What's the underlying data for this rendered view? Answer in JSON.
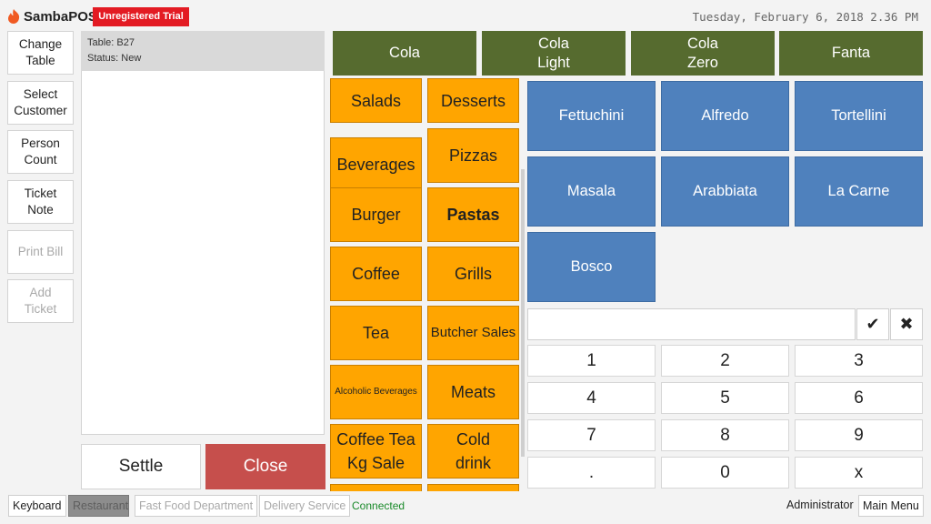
{
  "app": {
    "name": "SambaPOS",
    "trial_badge": "Unregistered Trial",
    "datetime": "Tuesday, February 6, 2018 2.36 PM",
    "logo_icon": "flame-icon",
    "brand_color": "#e31b23"
  },
  "commands": [
    {
      "label": "Change\nTable",
      "enabled": true
    },
    {
      "label": "Select\nCustomer",
      "enabled": true
    },
    {
      "label": "Person\nCount",
      "enabled": true
    },
    {
      "label": "Ticket\nNote",
      "enabled": true
    },
    {
      "label": "Print Bill",
      "enabled": false
    },
    {
      "label": "Add\nTicket",
      "enabled": false
    }
  ],
  "ticket": {
    "table": "Table: B27",
    "status": "Status: New",
    "settle_label": "Settle",
    "close_label": "Close",
    "close_color": "#c64f4c"
  },
  "favorites": [
    "Cola",
    "Cola\nLight",
    "Cola\nZero",
    "Fanta"
  ],
  "favorites_color": "#566b2f",
  "categories": [
    {
      "label": "Salads"
    },
    {
      "label": "Desserts"
    },
    {
      "label": "Beverages"
    },
    {
      "label": "Pizzas"
    },
    {
      "label": "Burger"
    },
    {
      "label": "Pastas",
      "selected": true
    },
    {
      "label": "Coffee"
    },
    {
      "label": "Grills"
    },
    {
      "label": "Tea"
    },
    {
      "label": "Butcher Sales"
    },
    {
      "label": "Alcoholic Beverages"
    },
    {
      "label": "Meats"
    },
    {
      "label": "Coffee Tea\nKg Sale"
    },
    {
      "label": "Cold\ndrink"
    }
  ],
  "categories_color": "#ffa500",
  "menu_items": [
    "Fettuchini",
    "Alfredo",
    "Tortellini",
    "Masala",
    "Arabbiata",
    "La Carne",
    "Bosco"
  ],
  "menu_items_color": "#4f81bd",
  "numpad": {
    "input_value": "",
    "ok_icon": "checkmark-icon",
    "clear_icon": "x-icon",
    "ok_glyph": "✔",
    "clear_glyph": "✖",
    "keys": [
      "1",
      "2",
      "3",
      "4",
      "5",
      "6",
      "7",
      "8",
      "9",
      ".",
      "0",
      "x"
    ]
  },
  "footer": {
    "keyboard": "Keyboard",
    "departments": [
      {
        "label": "Restaurant",
        "active": true
      },
      {
        "label": "Fast Food Department",
        "active": false
      },
      {
        "label": "Delivery Service",
        "active": false
      }
    ],
    "connection_status": "Connected",
    "user": "Administrator",
    "main_menu": "Main Menu"
  }
}
